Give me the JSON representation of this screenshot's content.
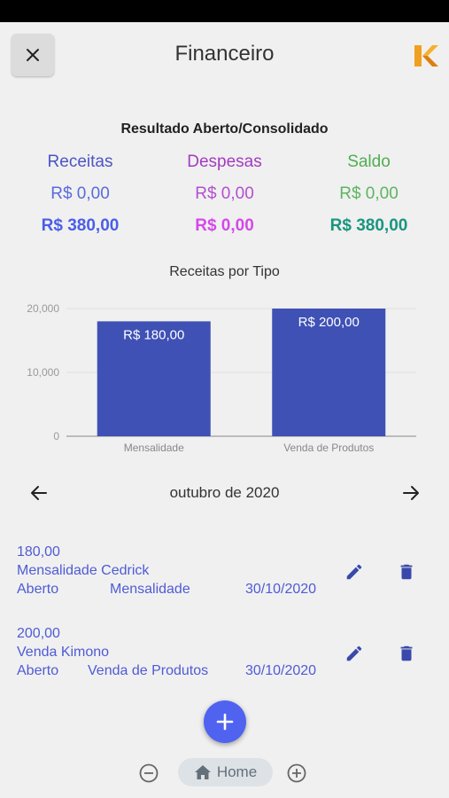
{
  "header": {
    "title": "Financeiro",
    "close_icon": "close-icon",
    "logo": "brand-logo-k"
  },
  "summary": {
    "title": "Resultado Aberto/Consolidado",
    "columns": [
      {
        "label": "Receitas",
        "open": "R$ 0,00",
        "total": "R$ 380,00",
        "head_color": "#4b55c4",
        "open_color": "#5a6bdb",
        "total_color": "#4a5ee8"
      },
      {
        "label": "Despesas",
        "open": "R$ 0,00",
        "total": "R$ 0,00",
        "head_color": "#a43bbf",
        "open_color": "#b44fd0",
        "total_color": "#d449e8"
      },
      {
        "label": "Saldo",
        "open": "R$ 0,00",
        "total": "R$ 380,00",
        "head_color": "#4fae52",
        "open_color": "#5cb560",
        "total_color": "#19967f"
      }
    ]
  },
  "chart_data": {
    "type": "bar",
    "title": "Receitas por Tipo",
    "categories": [
      "Mensalidade",
      "Venda de Produtos"
    ],
    "values": [
      18000,
      20000
    ],
    "data_labels": [
      "R$ 180,00",
      "R$ 200,00"
    ],
    "y_ticks": [
      "0",
      "10,000",
      "20,000"
    ],
    "y_tick_values": [
      0,
      10000,
      20000
    ],
    "ylim": [
      0,
      20000
    ],
    "bar_color": "#3f51b5",
    "grid": true
  },
  "month_nav": {
    "label": "outubro de 2020",
    "prev_icon": "arrow-left-icon",
    "next_icon": "arrow-right-icon"
  },
  "entries": [
    {
      "amount": "180,00",
      "description": "Mensalidade Cedrick",
      "status": "Aberto",
      "type": "Mensalidade",
      "date": "30/10/2020"
    },
    {
      "amount": "200,00",
      "description": "Venda Kimono",
      "status": "Aberto",
      "type": "Venda de Produtos",
      "date": "30/10/2020"
    }
  ],
  "colors": {
    "accent": "#4f63f0",
    "entry_text": "#4f5bd5",
    "icon_blue": "#3949ab"
  },
  "fab": {
    "icon": "plus-icon"
  },
  "bottom_bar": {
    "home_label": "Home",
    "zoom_out_icon": "zoom-out-icon",
    "zoom_in_icon": "zoom-in-icon",
    "home_icon": "home-icon"
  }
}
